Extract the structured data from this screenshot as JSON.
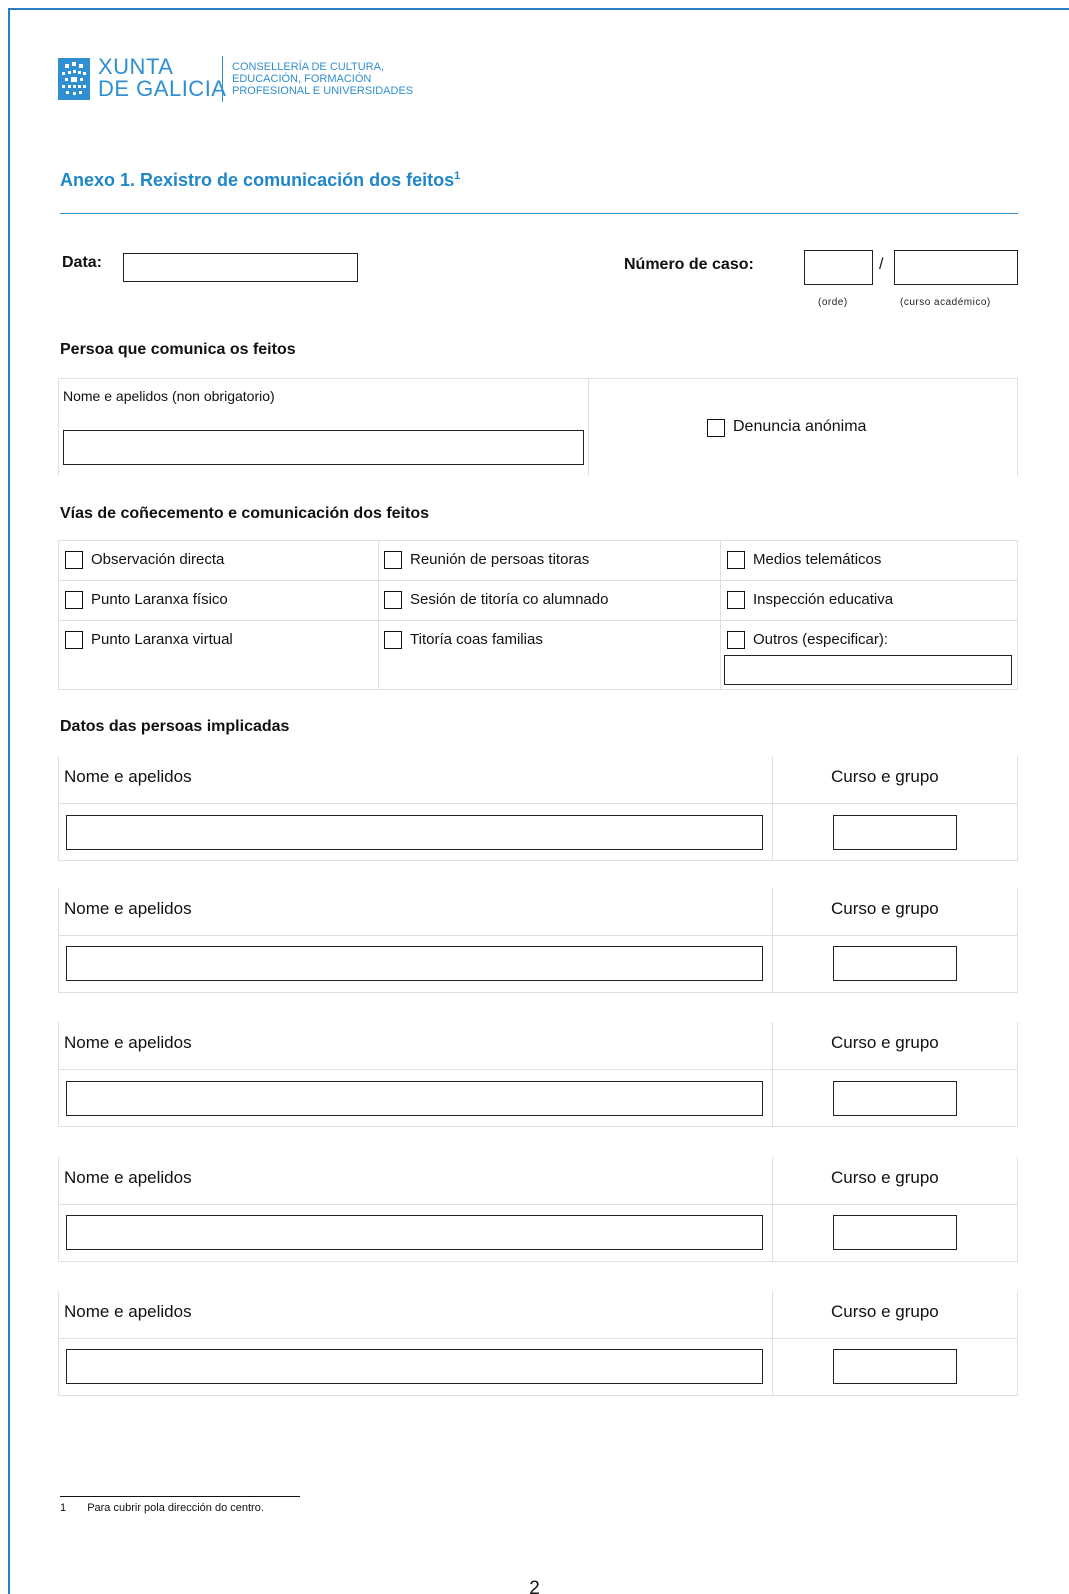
{
  "header": {
    "org_line1": "XUNTA",
    "org_line2": "DE GALICIA",
    "dept_line1": "CONSELLERÍA DE CULTURA,",
    "dept_line2": "EDUCACIÓN, FORMACIÓN",
    "dept_line3": "PROFESIONAL E UNIVERSIDADES",
    "logo": "galicia-coat-of-arms-icon",
    "accent_color": "#1f86c8"
  },
  "title": {
    "text": "Anexo 1. Rexistro de comunicación dos feitos",
    "footnote_mark": "1"
  },
  "fields": {
    "date_label": "Data:",
    "date_value": "",
    "case_label": "Número de caso:",
    "case_order_value": "",
    "case_separator": "/",
    "case_year_value": "",
    "case_order_hint": "(orde)",
    "case_year_hint": "(curso académico)"
  },
  "reporter": {
    "heading": "Persoa que comunica os feitos",
    "name_label": "Nome e apelidos (non obrigatorio)",
    "name_value": "",
    "anonymous_label": "Denuncia anónima"
  },
  "channels": {
    "heading": "Vías de coñecemento e comunicación dos feitos",
    "options": [
      "Observación directa",
      "Reunión de persoas titoras",
      "Medios telemáticos",
      "Punto Laranxa físico",
      "Sesión de titoría co alumnado",
      "Inspección educativa",
      "Punto Laranxa virtual",
      "Titoría coas familias",
      "Outros (especificar):"
    ],
    "other_value": ""
  },
  "people": {
    "heading": "Datos das persoas implicadas",
    "name_label": "Nome e apelidos",
    "group_label": "Curso e grupo",
    "rows": [
      {
        "name": "",
        "group": ""
      },
      {
        "name": "",
        "group": ""
      },
      {
        "name": "",
        "group": ""
      },
      {
        "name": "",
        "group": ""
      },
      {
        "name": "",
        "group": ""
      }
    ]
  },
  "footnote": {
    "number": "1",
    "text": "Para cubrir pola dirección do centro."
  },
  "page_number": "2"
}
